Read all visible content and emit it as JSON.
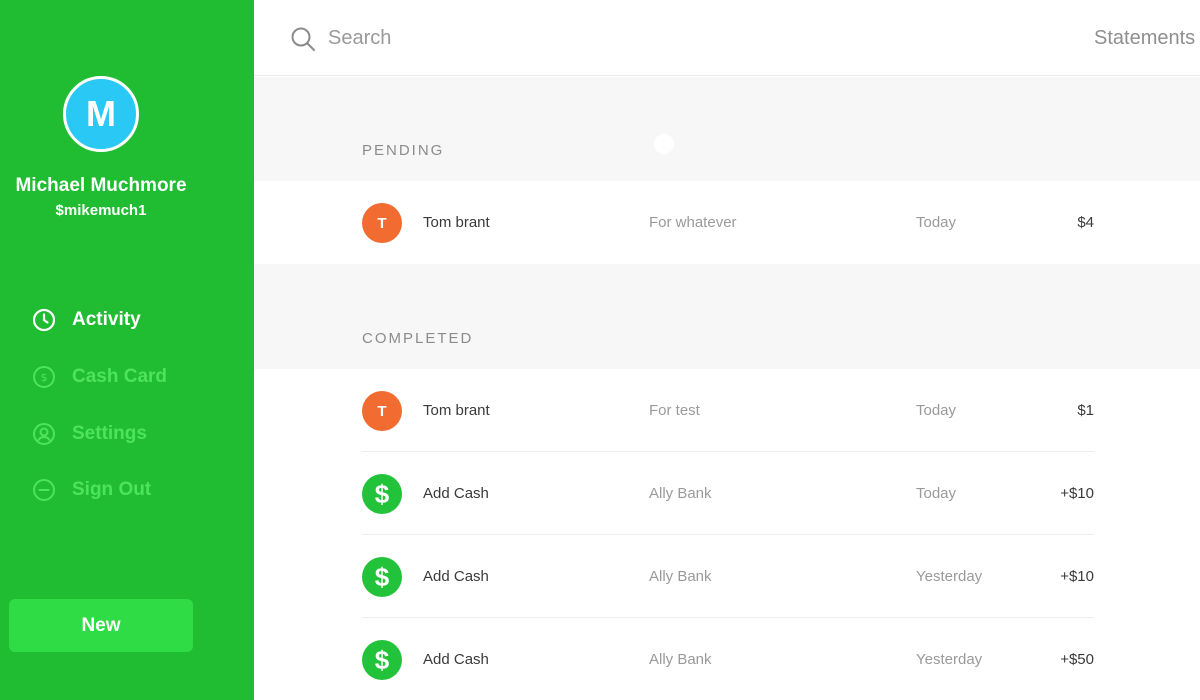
{
  "profile": {
    "initial": "M",
    "name": "Michael Muchmore",
    "cashtag": "$mikemuch1"
  },
  "nav": {
    "items": [
      {
        "label": "Activity",
        "icon": "clock-icon",
        "active": true
      },
      {
        "label": "Cash Card",
        "icon": "dollar-circle-icon",
        "active": false
      },
      {
        "label": "Settings",
        "icon": "user-circle-icon",
        "active": false
      },
      {
        "label": "Sign Out",
        "icon": "minus-circle-icon",
        "active": false
      }
    ],
    "new_label": "New"
  },
  "topbar": {
    "search_placeholder": "Search",
    "statements_label": "Statements"
  },
  "pending": {
    "header": "PENDING",
    "rows": [
      {
        "avatar": "T",
        "name": "Tom brant",
        "note": "For whatever",
        "date": "Today",
        "amount": "$4"
      }
    ]
  },
  "completed": {
    "header": "COMPLETED",
    "rows": [
      {
        "avatar": "T",
        "name": "Tom brant",
        "note": "For test",
        "date": "Today",
        "amount": "$1"
      },
      {
        "avatar": "$",
        "name": "Add Cash",
        "note": "Ally Bank",
        "date": "Today",
        "amount": "+$10"
      },
      {
        "avatar": "$",
        "name": "Add Cash",
        "note": "Ally Bank",
        "date": "Yesterday",
        "amount": "+$10"
      },
      {
        "avatar": "$",
        "name": "Add Cash",
        "note": "Ally Bank",
        "date": "Yesterday",
        "amount": "+$50"
      }
    ]
  },
  "colors": {
    "sidebar": "#20bd33",
    "avatar_blue": "#29c8f5",
    "avatar_orange": "#f26b30",
    "cash_green": "#22c33a",
    "nav_inactive": "#4ee35a",
    "new_button": "#2fdc45"
  }
}
